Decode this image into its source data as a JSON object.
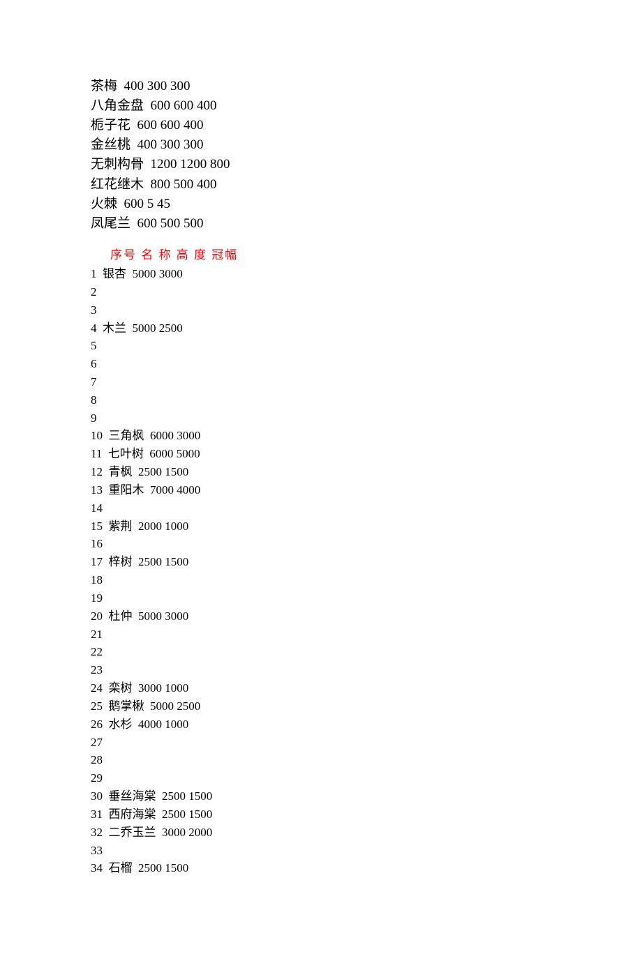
{
  "top_list": [
    {
      "name": "茶梅",
      "values": "400 300 300"
    },
    {
      "name": "八角金盘",
      "values": "600 600 400"
    },
    {
      "name": "栀子花",
      "values": "600 600 400"
    },
    {
      "name": "金丝桃",
      "values": "400 300 300"
    },
    {
      "name": "无刺构骨",
      "values": "1200 1200 800"
    },
    {
      "name": "红花继木",
      "values": "800 500 400"
    },
    {
      "name": "火棘",
      "values": "600 5 45"
    },
    {
      "name": "凤尾兰",
      "values": "600 500 500"
    }
  ],
  "header": "序号  名 称  高 度  冠幅",
  "rows": [
    {
      "idx": "1",
      "name": "银杏",
      "values": "5000 3000"
    },
    {
      "idx": "2",
      "name": "",
      "values": ""
    },
    {
      "idx": "3",
      "name": "",
      "values": ""
    },
    {
      "idx": "4",
      "name": "木兰",
      "values": "5000 2500"
    },
    {
      "idx": "5",
      "name": "",
      "values": ""
    },
    {
      "idx": "6",
      "name": "",
      "values": ""
    },
    {
      "idx": "7",
      "name": "",
      "values": ""
    },
    {
      "idx": "8",
      "name": "",
      "values": ""
    },
    {
      "idx": "9",
      "name": "",
      "values": ""
    },
    {
      "idx": "10",
      "name": "三角枫",
      "values": "6000 3000"
    },
    {
      "idx": "11",
      "name": "七叶树",
      "values": "6000 5000"
    },
    {
      "idx": "12",
      "name": "青枫",
      "values": "2500 1500"
    },
    {
      "idx": "13",
      "name": "重阳木",
      "values": "7000 4000"
    },
    {
      "idx": "14",
      "name": "",
      "values": ""
    },
    {
      "idx": "15",
      "name": "紫荆",
      "values": "2000 1000"
    },
    {
      "idx": "16",
      "name": "",
      "values": ""
    },
    {
      "idx": "17",
      "name": "梓树",
      "values": "2500 1500"
    },
    {
      "idx": "18",
      "name": "",
      "values": ""
    },
    {
      "idx": "19",
      "name": "",
      "values": ""
    },
    {
      "idx": "20",
      "name": "杜仲",
      "values": "5000 3000"
    },
    {
      "idx": "21",
      "name": "",
      "values": ""
    },
    {
      "idx": "22",
      "name": "",
      "values": ""
    },
    {
      "idx": "23",
      "name": "",
      "values": ""
    },
    {
      "idx": "24",
      "name": "栾树",
      "values": "3000 1000"
    },
    {
      "idx": "25",
      "name": "鹅掌楸",
      "values": "5000 2500"
    },
    {
      "idx": "26",
      "name": "水杉",
      "values": "4000 1000"
    },
    {
      "idx": "27",
      "name": "",
      "values": ""
    },
    {
      "idx": "28",
      "name": "",
      "values": ""
    },
    {
      "idx": "29",
      "name": "",
      "values": ""
    },
    {
      "idx": "30",
      "name": "垂丝海棠",
      "values": "2500 1500"
    },
    {
      "idx": "31",
      "name": "西府海棠",
      "values": "2500 1500"
    },
    {
      "idx": "32",
      "name": "二乔玉兰",
      "values": "3000 2000"
    },
    {
      "idx": "33",
      "name": "",
      "values": ""
    },
    {
      "idx": "34",
      "name": "石榴",
      "values": "2500 1500"
    }
  ]
}
